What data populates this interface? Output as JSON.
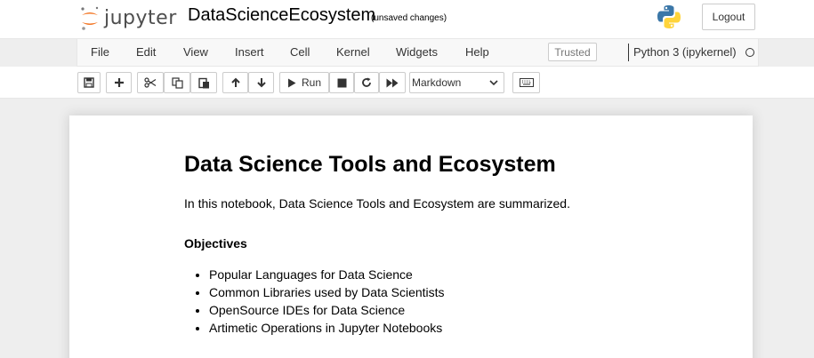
{
  "header": {
    "logo_text": "jupyter",
    "notebook_title": "DataScienceEcosystem",
    "save_status": "(unsaved changes)",
    "logout_label": "Logout"
  },
  "menubar": {
    "items": [
      "File",
      "Edit",
      "View",
      "Insert",
      "Cell",
      "Kernel",
      "Widgets",
      "Help"
    ],
    "trusted_label": "Trusted",
    "kernel_name": "Python 3 (ipykernel)"
  },
  "toolbar": {
    "run_label": "Run",
    "cell_type": "Markdown"
  },
  "cell": {
    "heading": "Data Science Tools and Ecosystem",
    "intro": "In this notebook, Data Science Tools and Ecosystem are summarized.",
    "objectives_heading": "Objectives",
    "objectives": [
      "Popular Languages for Data Science",
      "Common Libraries used by Data Scientists",
      "OpenSource IDEs for Data Science",
      "Artimetic Operations in Jupyter Notebooks"
    ]
  },
  "colors": {
    "jupyter_orange": "#f37726",
    "python_blue": "#3b77a8",
    "python_yellow": "#ffd43b"
  }
}
